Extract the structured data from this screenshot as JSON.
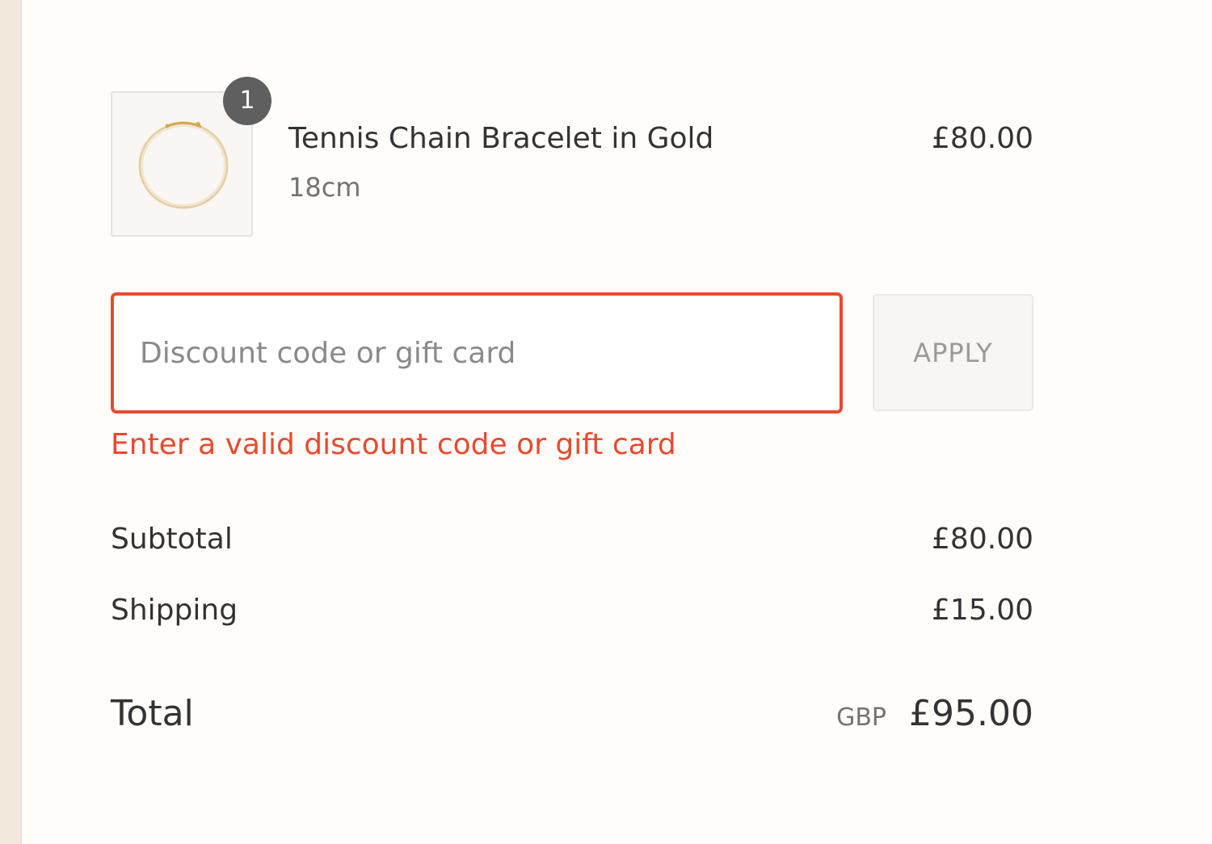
{
  "line_item": {
    "quantity": "1",
    "name": "Tennis Chain Bracelet in Gold",
    "variant": "18cm",
    "price": "£80.00",
    "thumbnail_icon": "bracelet-image"
  },
  "discount": {
    "placeholder": "Discount code or gift card",
    "value": "",
    "apply_label": "APPLY",
    "error": "Enter a valid discount code or gift card"
  },
  "summary": {
    "subtotal_label": "Subtotal",
    "subtotal_value": "£80.00",
    "shipping_label": "Shipping",
    "shipping_value": "£15.00",
    "total_label": "Total",
    "currency": "GBP",
    "total_value": "£95.00"
  },
  "colors": {
    "error": "#e84a2e",
    "badge": "#5f5f5f",
    "background": "#fffcfa",
    "sidebar_strip": "#f2e8dc"
  }
}
